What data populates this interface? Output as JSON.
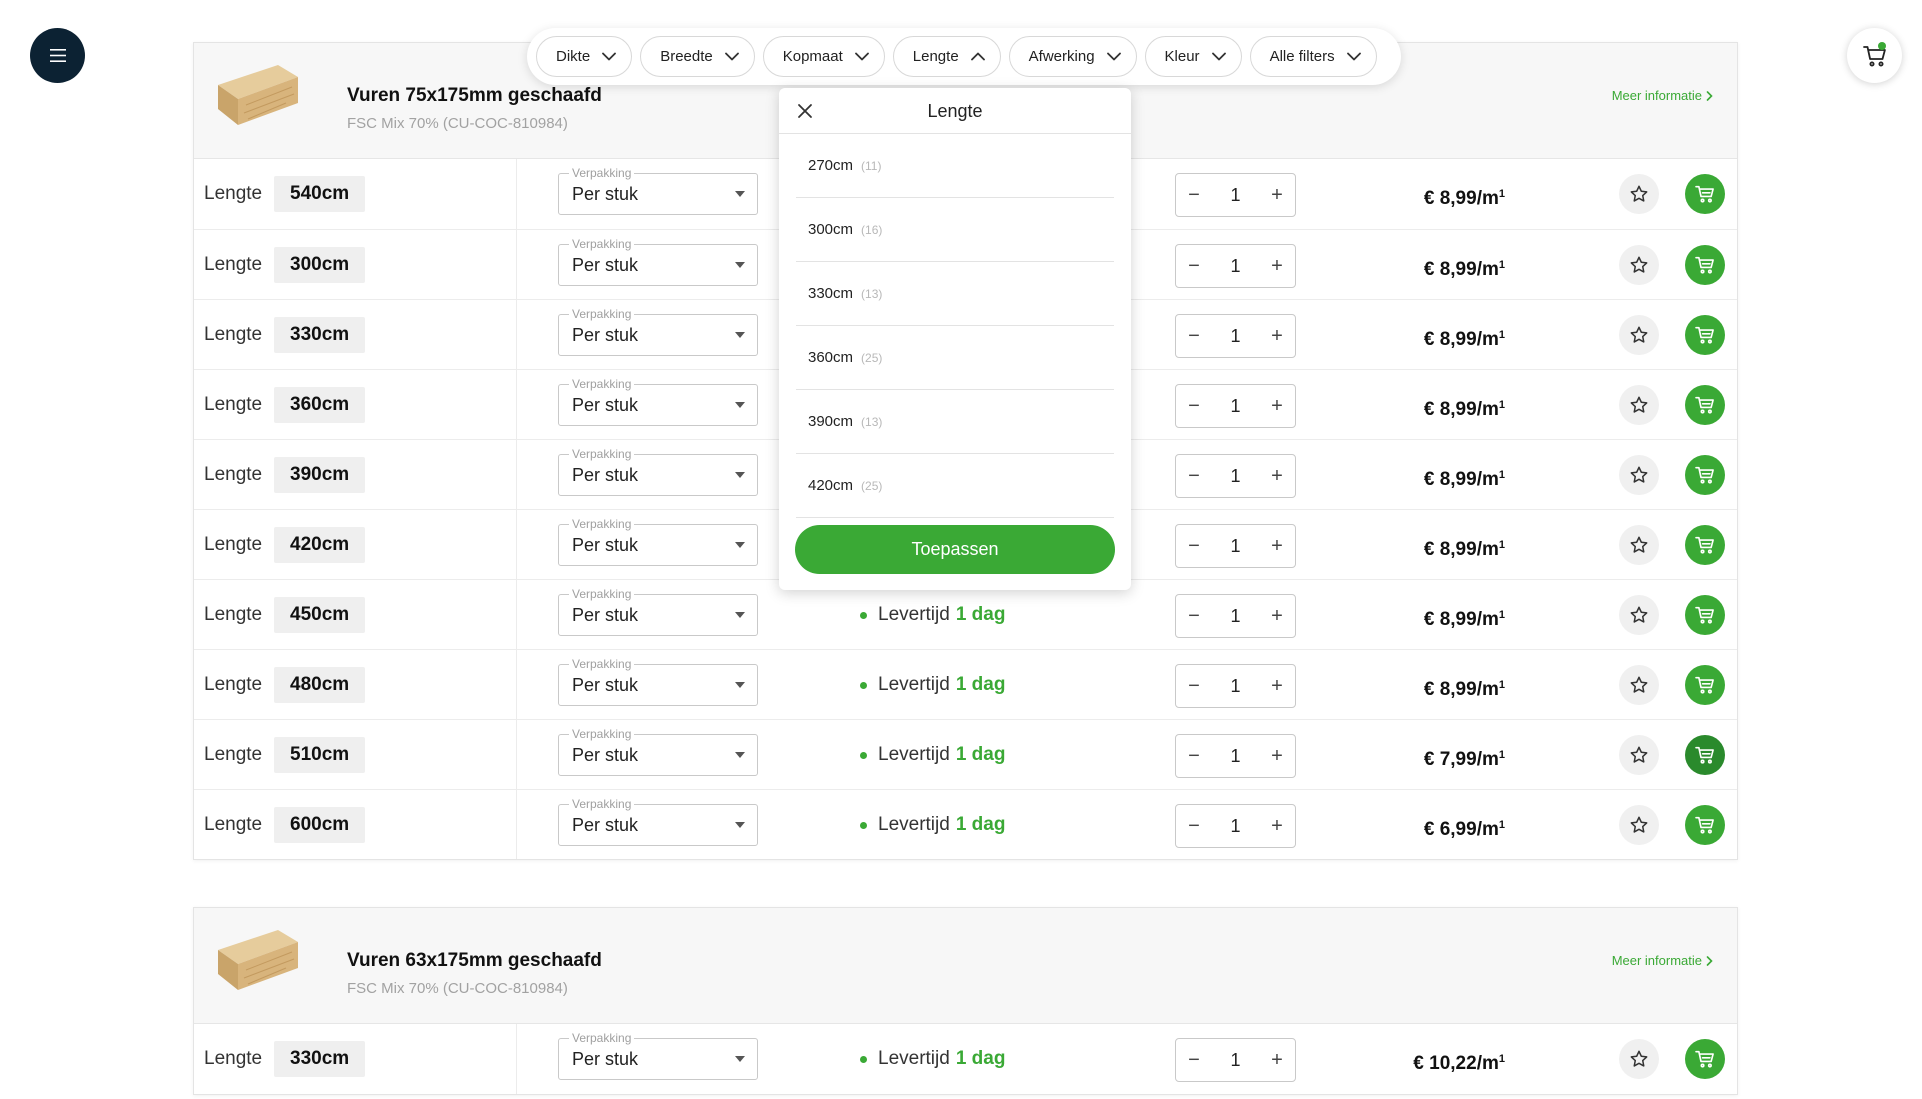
{
  "header": {
    "menu_icon": "hamburger-icon",
    "cart_icon": "cart-icon",
    "cart_indicator_color": "#3aa935"
  },
  "filters": [
    {
      "label": "Dikte",
      "open": false
    },
    {
      "label": "Breedte",
      "open": false
    },
    {
      "label": "Kopmaat",
      "open": false
    },
    {
      "label": "Lengte",
      "open": true
    },
    {
      "label": "Afwerking",
      "open": false
    },
    {
      "label": "Kleur",
      "open": false
    },
    {
      "label": "Alle filters",
      "open": false
    }
  ],
  "dropdown": {
    "title": "Lengte",
    "options": [
      {
        "value": "270cm",
        "count": "(11)"
      },
      {
        "value": "300cm",
        "count": "(16)"
      },
      {
        "value": "330cm",
        "count": "(13)"
      },
      {
        "value": "360cm",
        "count": "(25)"
      },
      {
        "value": "390cm",
        "count": "(13)"
      },
      {
        "value": "420cm",
        "count": "(25)"
      }
    ],
    "apply_label": "Toepassen"
  },
  "common": {
    "length_label": "Lengte",
    "pack_label": "Verpakking",
    "pack_value": "Per stuk",
    "lev_label": "Levertijd",
    "lev_value": "1 dag",
    "more_label": "Meer informatie",
    "unit": "/m",
    "unit_sup": "1",
    "accent": "#3aa935"
  },
  "products": [
    {
      "title": "Vuren 75x175mm geschaafd",
      "subtitle": "FSC Mix 70% (CU-COC-810984)",
      "rows": [
        {
          "length": "540cm",
          "qty": "1",
          "price": "€ 8,99",
          "show_lev": false
        },
        {
          "length": "300cm",
          "qty": "1",
          "price": "€ 8,99",
          "show_lev": false
        },
        {
          "length": "330cm",
          "qty": "1",
          "price": "€ 8,99",
          "show_lev": false
        },
        {
          "length": "360cm",
          "qty": "1",
          "price": "€ 8,99",
          "show_lev": false
        },
        {
          "length": "390cm",
          "qty": "1",
          "price": "€ 8,99",
          "show_lev": false
        },
        {
          "length": "420cm",
          "qty": "1",
          "price": "€ 8,99",
          "show_lev": false
        },
        {
          "length": "450cm",
          "qty": "1",
          "price": "€ 8,99",
          "show_lev": true
        },
        {
          "length": "480cm",
          "qty": "1",
          "price": "€ 8,99",
          "show_lev": true
        },
        {
          "length": "510cm",
          "qty": "1",
          "price": "€ 7,99",
          "show_lev": true,
          "hover": true
        },
        {
          "length": "600cm",
          "qty": "1",
          "price": "€ 6,99",
          "show_lev": true
        }
      ]
    },
    {
      "title": "Vuren 63x175mm geschaafd",
      "subtitle": "FSC Mix 70% (CU-COC-810984)",
      "rows": [
        {
          "length": "330cm",
          "qty": "1",
          "price": "€ 10,22",
          "show_lev": true
        }
      ]
    }
  ]
}
